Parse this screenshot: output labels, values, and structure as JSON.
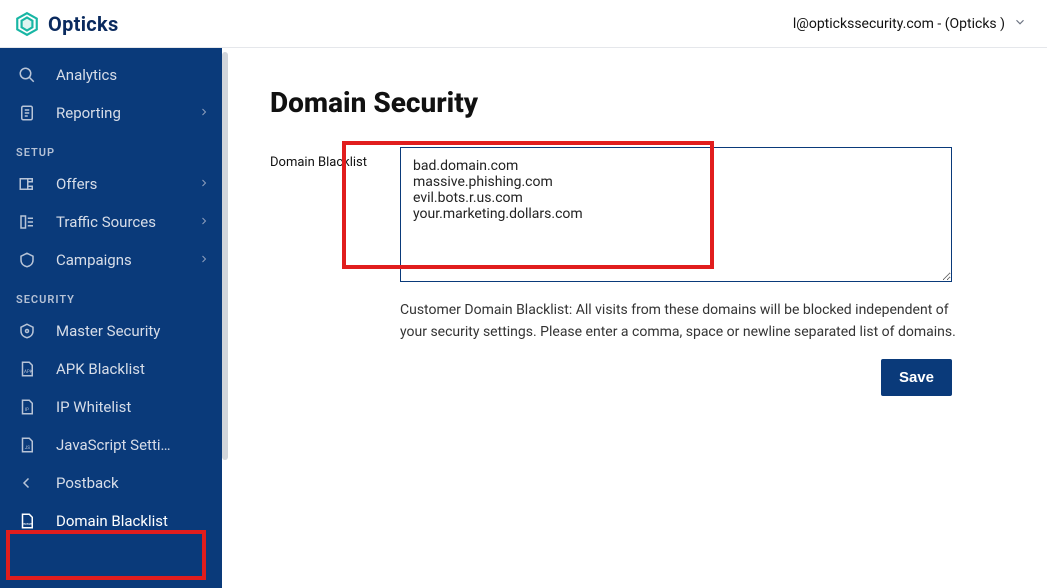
{
  "brand": {
    "name": "Opticks"
  },
  "header": {
    "account_label": "l@optickssecurity.com - (Opticks )"
  },
  "sidebar": {
    "items_top": [
      {
        "label": "Analytics",
        "icon": "analytics"
      },
      {
        "label": "Reporting",
        "icon": "reporting",
        "has_children": true
      }
    ],
    "section_setup_label": "SETUP",
    "items_setup": [
      {
        "label": "Offers",
        "icon": "offers",
        "has_children": true
      },
      {
        "label": "Traffic Sources",
        "icon": "traffic-sources",
        "has_children": true
      },
      {
        "label": "Campaigns",
        "icon": "campaigns",
        "has_children": true
      }
    ],
    "section_security_label": "SECURITY",
    "items_security": [
      {
        "label": "Master Security",
        "icon": "master-security"
      },
      {
        "label": "APK Blacklist",
        "icon": "apk-blacklist"
      },
      {
        "label": "IP Whitelist",
        "icon": "ip-whitelist"
      },
      {
        "label": "JavaScript Setti…",
        "icon": "javascript-settings"
      },
      {
        "label": "Postback",
        "icon": "postback"
      },
      {
        "label": "Domain Blacklist",
        "icon": "domain-blacklist",
        "active": true
      }
    ]
  },
  "main": {
    "title": "Domain Security",
    "field_label": "Domain Blacklist",
    "textarea_value": "bad.domain.com\nmassive.phishing.com\nevil.bots.r.us.com\nyour.marketing.dollars.com",
    "helper_text": "Customer Domain Blacklist: All visits from these domains will be blocked independent of your security settings. Please enter a comma, space or newline separated list of domains.",
    "save_label": "Save"
  },
  "colors": {
    "accent": "#0a3a7a",
    "highlight": "#e11d1d"
  }
}
